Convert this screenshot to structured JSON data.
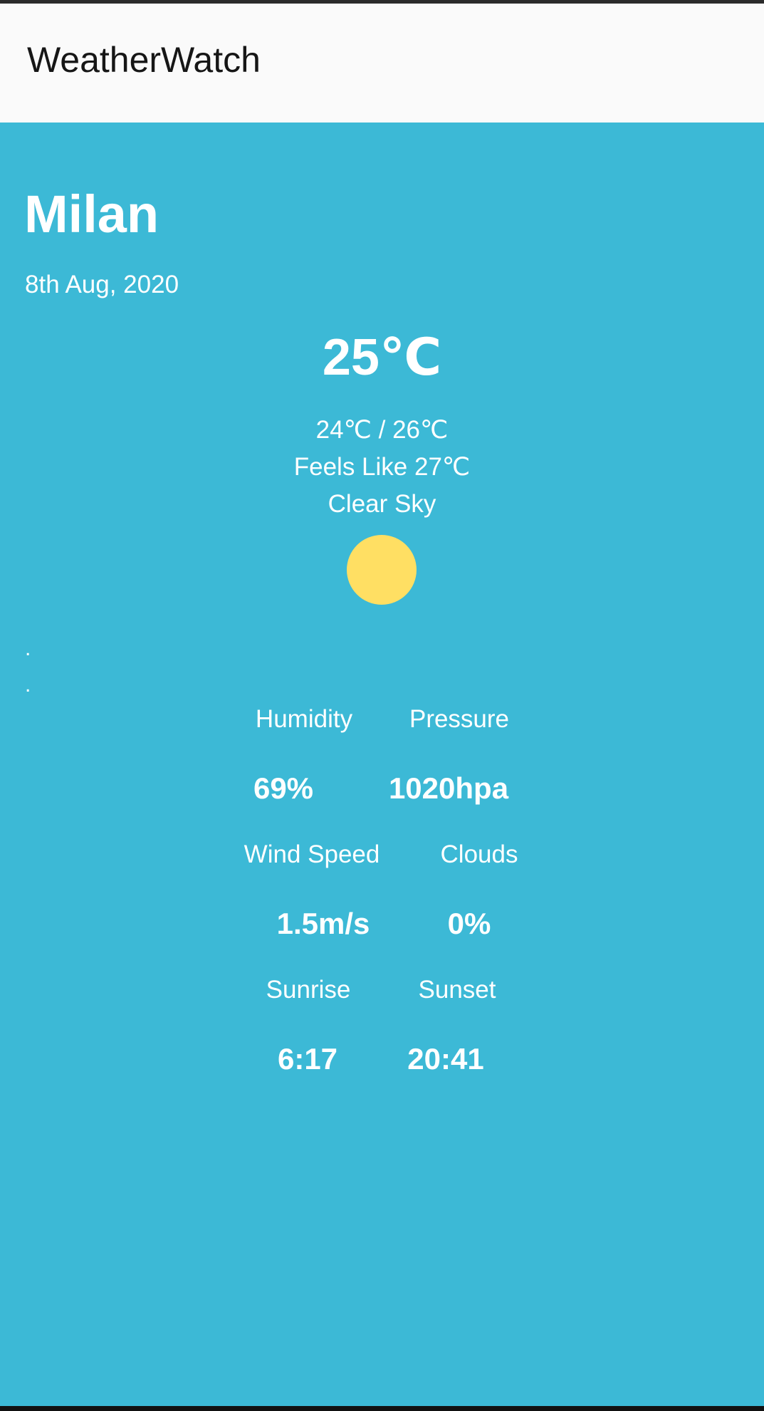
{
  "app": {
    "title": "WeatherWatch"
  },
  "weather": {
    "city": "Milan",
    "date": "8th Aug, 2020",
    "temperature": "25℃",
    "min_max": "24℃ / 26℃",
    "feels_like": "Feels Like 27℃",
    "condition": "Clear Sky",
    "condition_icon": "sun-icon",
    "placeholder_lines": [
      ".",
      "."
    ]
  },
  "details": {
    "humidity": {
      "label": "Humidity",
      "value": "69%"
    },
    "pressure": {
      "label": "Pressure",
      "value": "1020hpa"
    },
    "wind_speed": {
      "label": "Wind Speed",
      "value": "1.5m/s"
    },
    "clouds": {
      "label": "Clouds",
      "value": "0%"
    },
    "sunrise": {
      "label": "Sunrise",
      "value": "6:17"
    },
    "sunset": {
      "label": "Sunset",
      "value": "20:41"
    }
  },
  "colors": {
    "app_bar_background": "#fafafa",
    "main_background": "#3cb9d6",
    "sun": "#ffdf63",
    "text_light": "#ffffff",
    "text_dark": "#161616"
  }
}
